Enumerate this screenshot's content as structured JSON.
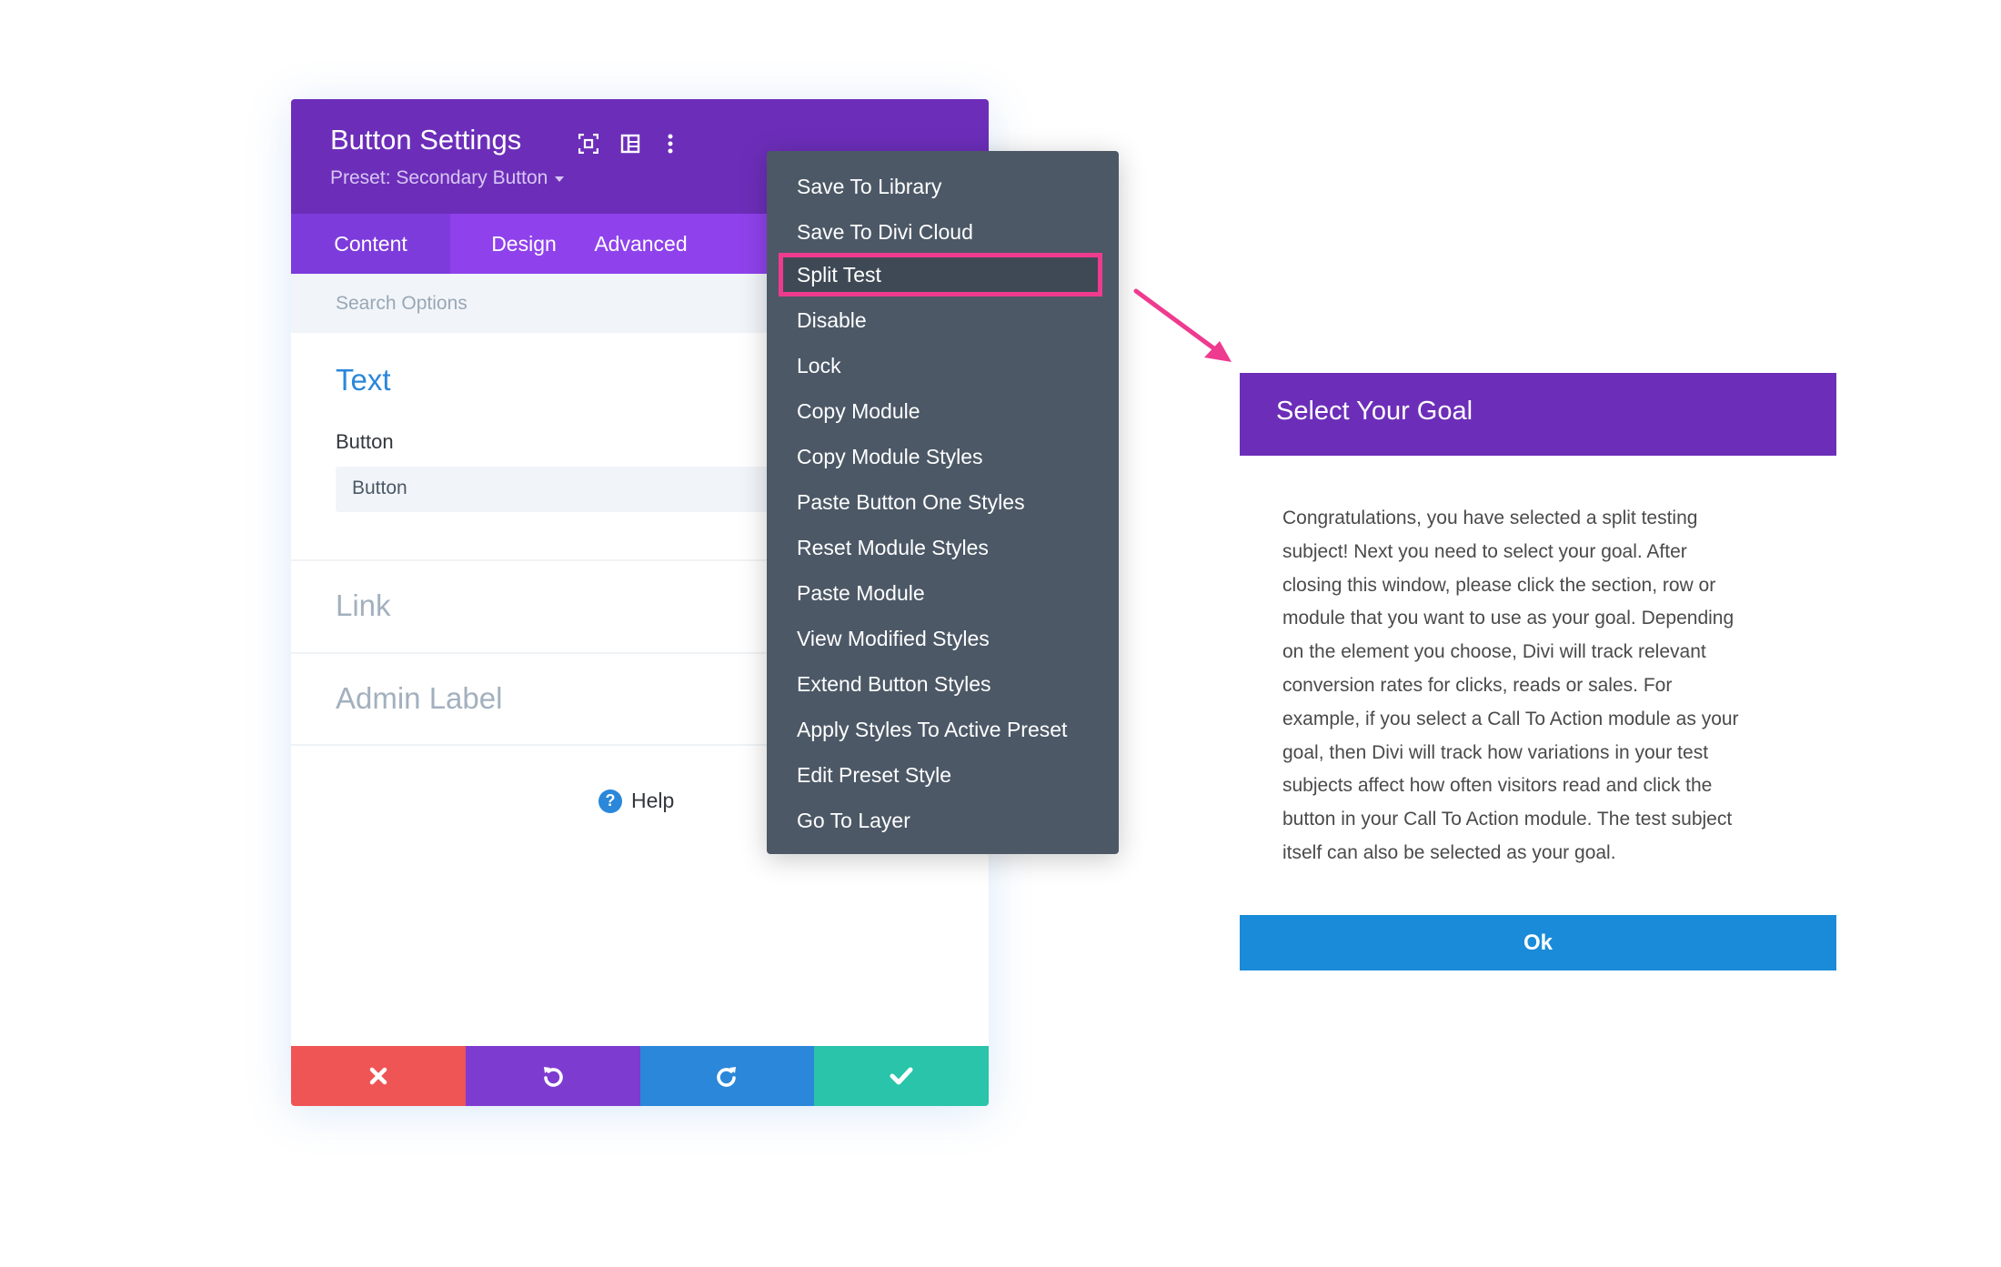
{
  "panel": {
    "title": "Button Settings",
    "preset": "Preset: Secondary Button",
    "header_icons": [
      "expand-icon",
      "split-view-icon",
      "more-options-icon"
    ],
    "tabs": [
      {
        "label": "Content",
        "active": true
      },
      {
        "label": "Design",
        "active": false
      },
      {
        "label": "Advanced",
        "active": false
      }
    ],
    "search_placeholder": "Search Options",
    "section_text": {
      "title": "Text",
      "field_label": "Button",
      "field_value": "Button"
    },
    "section_link": {
      "title": "Link"
    },
    "section_admin_label": {
      "title": "Admin Label"
    },
    "help_label": "Help",
    "footer_buttons": [
      "close-icon",
      "undo-icon",
      "redo-icon",
      "check-icon"
    ]
  },
  "context_menu": {
    "items": [
      "Save To Library",
      "Save To Divi Cloud",
      "Split Test",
      "Disable",
      "Lock",
      "Copy Module",
      "Copy Module Styles",
      "Paste Button One Styles",
      "Reset Module Styles",
      "Paste Module",
      "View Modified Styles",
      "Extend Button Styles",
      "Apply Styles To Active Preset",
      "Edit Preset Style",
      "Go To Layer"
    ],
    "highlighted": "Split Test"
  },
  "goal_dialog": {
    "title": "Select Your Goal",
    "body_lines": [
      "Congratulations, you have selected a split testing",
      "subject! Next you need to select your goal. After",
      "closing this window, please click the section, row or",
      "module that you want to use as your goal. Depending",
      "on the element you choose, Divi will track relevant",
      "conversion rates for clicks, reads or sales. For",
      "example, if you select a Call To Action module as your",
      "goal, then Divi will track how variations in your test",
      "subjects affect how often visitors read and click the",
      "button in your Call To Action module. The test subject",
      "itself can also be selected as your goal."
    ],
    "ok_label": "Ok"
  },
  "colors": {
    "purple_header": "#6c2eb9",
    "purple_tabs": "#8f42ec",
    "menu_bg": "#4c5866",
    "highlight_border": "#ee3b8f",
    "ok_blue": "#1a8bd9",
    "cancel_red": "#ef5555",
    "save_green": "#29c4a9"
  }
}
